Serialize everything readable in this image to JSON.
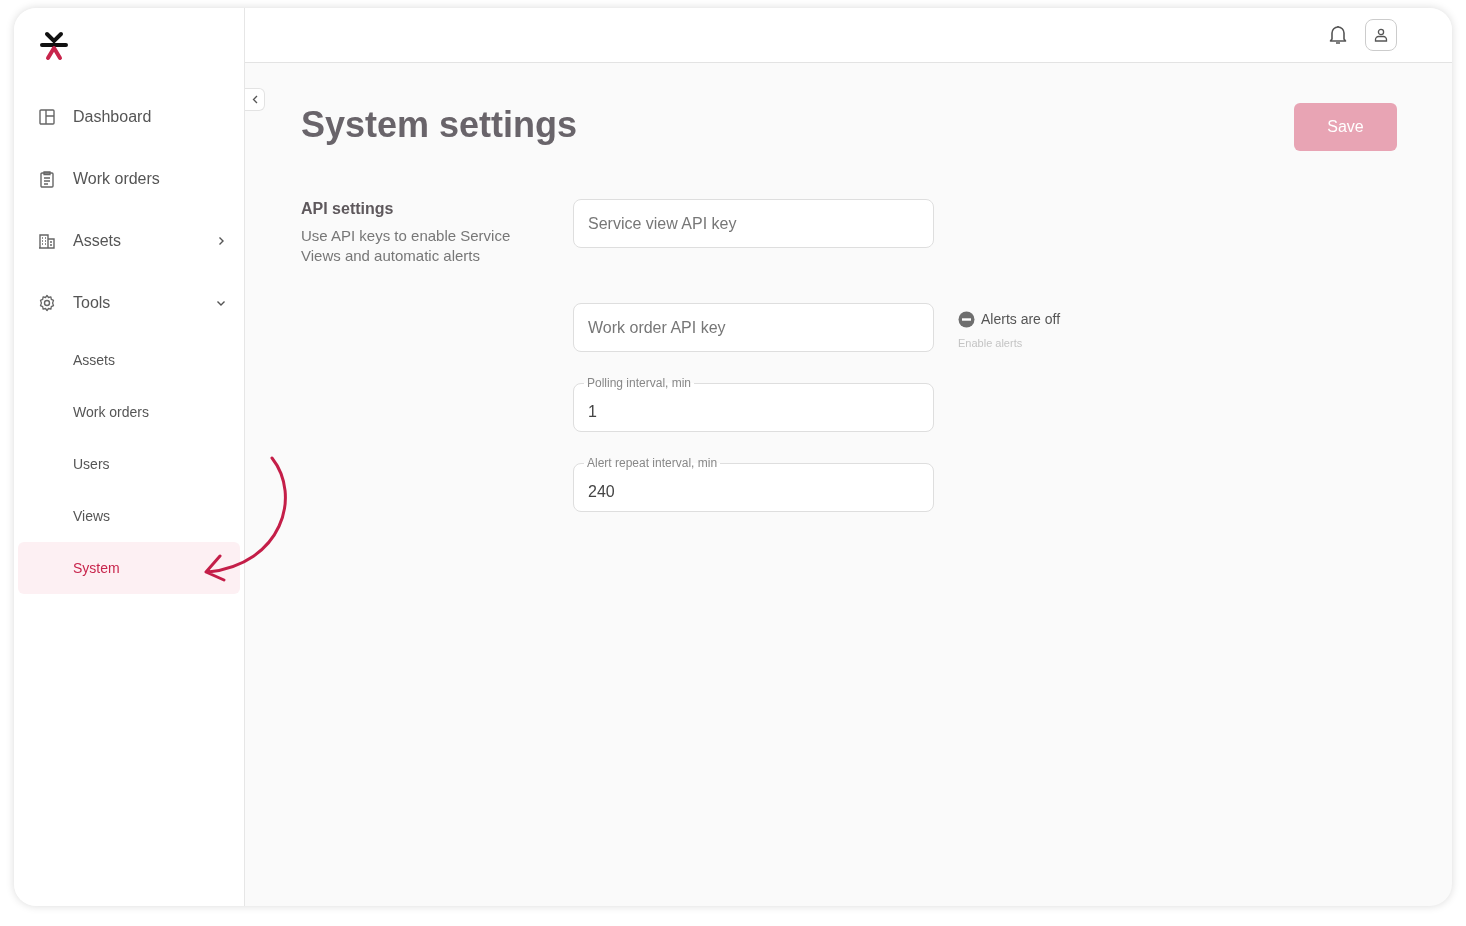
{
  "sidebar": {
    "items": [
      {
        "label": "Dashboard",
        "kind": "main",
        "selected": false
      },
      {
        "label": "Work orders",
        "kind": "main",
        "selected": false
      },
      {
        "label": "Assets",
        "kind": "main",
        "selected": false,
        "expanded": false
      },
      {
        "label": "Tools",
        "kind": "main",
        "selected": false,
        "expanded": true
      },
      {
        "label": "Assets",
        "kind": "sub",
        "selected": false
      },
      {
        "label": "Work orders",
        "kind": "sub",
        "selected": false
      },
      {
        "label": "Users",
        "kind": "sub",
        "selected": false
      },
      {
        "label": "Views",
        "kind": "sub",
        "selected": false
      },
      {
        "label": "System",
        "kind": "sub",
        "selected": true
      }
    ]
  },
  "page": {
    "title": "System settings",
    "save_button": {
      "label": "Save",
      "disabled": true
    }
  },
  "api_settings": {
    "heading": "API settings",
    "description": "Use API keys to enable Service Views and automatic alerts",
    "fields": [
      {
        "kind": "plain",
        "placeholder": "Service view API key"
      },
      {
        "kind": "plain",
        "placeholder": "Work order API key"
      },
      {
        "kind": "labeled",
        "label": "Polling interval, min",
        "value": "1"
      },
      {
        "kind": "labeled",
        "label": "Alert repeat interval, min",
        "value": "240"
      }
    ],
    "alerts": {
      "status": "Alerts are off",
      "on": false,
      "action": "Enable alerts"
    }
  }
}
